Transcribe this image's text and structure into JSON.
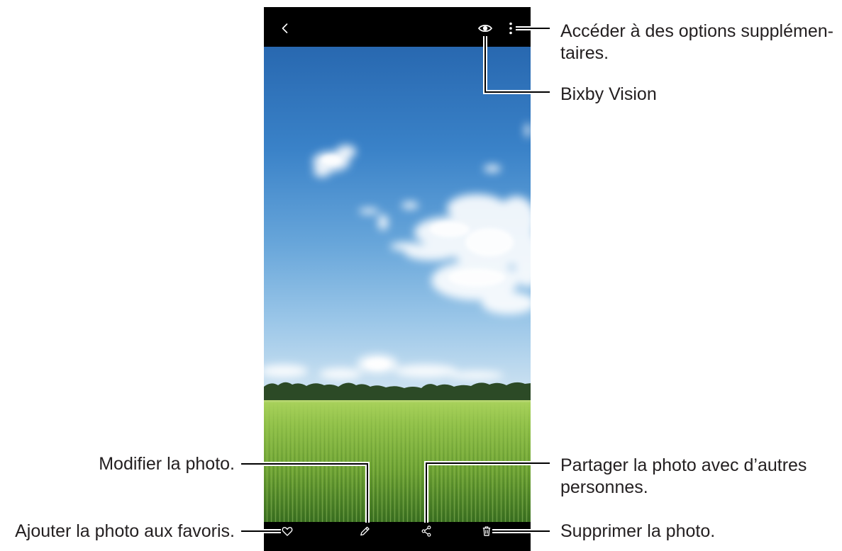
{
  "screen": {
    "top_bar": {
      "back_icon": "chevron-left-icon",
      "bixby_vision_icon": "eye-icon",
      "more_options_icon": "more-vertical-icon"
    },
    "bottom_bar": {
      "favorite_icon": "heart-icon",
      "edit_icon": "pencil-icon",
      "share_icon": "share-icon",
      "delete_icon": "trash-icon"
    }
  },
  "callouts": {
    "more_options": {
      "lines": [
        "Accéder à des options supplémen-",
        "taires."
      ]
    },
    "bixby_vision": {
      "lines": [
        "Bixby Vision"
      ]
    },
    "share": {
      "lines": [
        "Partager la photo avec d’autres",
        "personnes."
      ]
    },
    "delete": {
      "lines": [
        "Supprimer la photo."
      ]
    },
    "edit": {
      "lines": [
        "Modifier la photo."
      ]
    },
    "favorite": {
      "lines": [
        "Ajouter la photo aux favoris."
      ]
    }
  },
  "colors": {
    "bar_background": "#000000",
    "icon": "#ffffff",
    "callout_text": "#231f20",
    "callout_line": "#000000",
    "callout_line_outline": "#ffffff"
  }
}
